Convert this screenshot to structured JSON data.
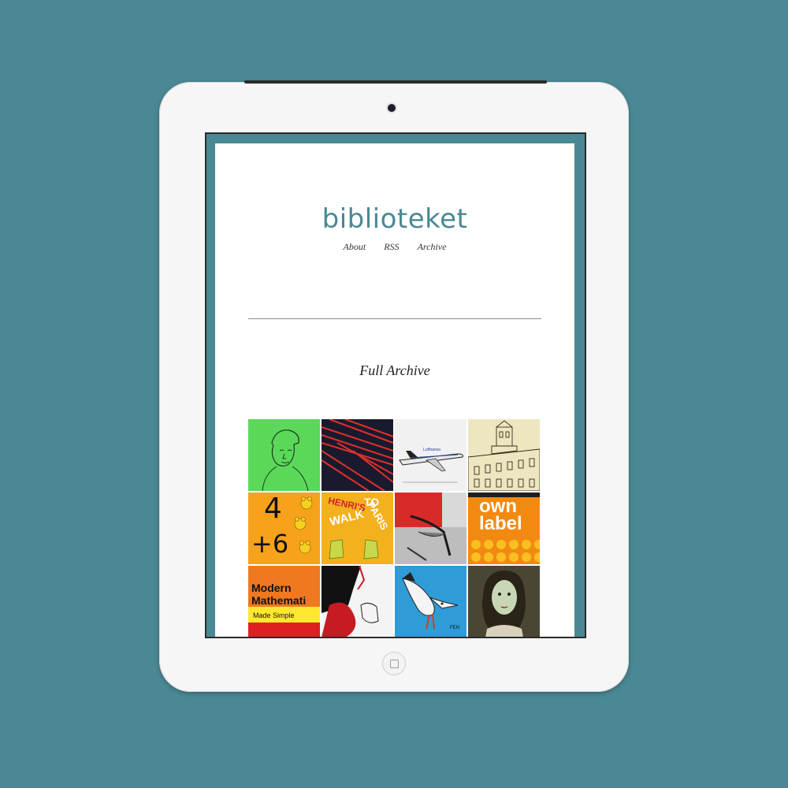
{
  "site": {
    "logo": "biblioteket",
    "nav": [
      "About",
      "RSS",
      "Archive"
    ]
  },
  "archive": {
    "title": "Full Archive",
    "covers": [
      {
        "name": "green-portrait-cover",
        "text": ""
      },
      {
        "name": "red-lines-cover",
        "text": ""
      },
      {
        "name": "lufthansa-plane-cover",
        "text": "Lufthansa"
      },
      {
        "name": "building-sketch-cover",
        "text": ""
      },
      {
        "name": "four-plus-six-cover",
        "text_top": "4",
        "text_bottom": "+6"
      },
      {
        "name": "henris-walk-cover",
        "text_a": "HENRI'S",
        "text_b": "WALK",
        "text_c": "TO",
        "text_d": "PARIS"
      },
      {
        "name": "chair-photo-cover",
        "text": ""
      },
      {
        "name": "own-label-cover",
        "text_top": "own",
        "text_bottom": "label"
      },
      {
        "name": "modern-mathematics-cover",
        "text_top": "Modern",
        "text_mid": "Mathemati",
        "text_bottom": "Made Simple"
      },
      {
        "name": "black-red-illustration-cover",
        "text": ""
      },
      {
        "name": "bird-illustration-cover",
        "text": "FEN"
      },
      {
        "name": "woman-portrait-cover",
        "text": ""
      }
    ]
  },
  "colors": {
    "background": "#4a8894",
    "logo": "#4a8894"
  }
}
